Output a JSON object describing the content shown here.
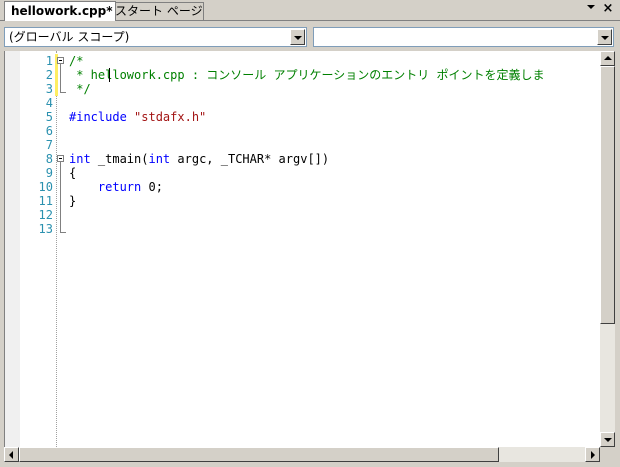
{
  "tabs": [
    {
      "label": "hellowork.cpp*",
      "active": true
    },
    {
      "label": "スタート ページ",
      "active": false
    }
  ],
  "tab_controls": {
    "dropdown_icon": "chevron-down-icon",
    "close_icon": "close-icon",
    "close_glyph": "×"
  },
  "navbar": {
    "scope_combo": "(グローバル スコープ)",
    "member_combo": ""
  },
  "colors": {
    "keyword": "#0000ff",
    "comment": "#008000",
    "string": "#a31515",
    "line_number": "#2b91af",
    "changed_line_marker": "#ffee62"
  },
  "editor": {
    "line_numbers": [
      "1",
      "2",
      "3",
      "4",
      "5",
      "6",
      "7",
      "8",
      "9",
      "10",
      "11",
      "12",
      "13"
    ],
    "lines": [
      [
        {
          "t": "/*",
          "c": "cm"
        }
      ],
      [
        {
          "t": " * hellowork.cpp : コンソール アプリケーションのエントリ ポイントを定義しま",
          "c": "cm"
        }
      ],
      [
        {
          "t": " */",
          "c": "cm"
        }
      ],
      [],
      [
        {
          "t": "#include ",
          "c": "kw"
        },
        {
          "t": "\"stdafx.h\"",
          "c": "st"
        }
      ],
      [],
      [],
      [
        {
          "t": "int",
          "c": "kw"
        },
        {
          "t": " _tmain(",
          "c": ""
        },
        {
          "t": "int",
          "c": "kw"
        },
        {
          "t": " argc, _TCHAR* argv[])",
          "c": ""
        }
      ],
      [
        {
          "t": "{",
          "c": ""
        }
      ],
      [
        {
          "t": "    ",
          "c": ""
        },
        {
          "t": "return",
          "c": "kw"
        },
        {
          "t": " 0;",
          "c": ""
        }
      ],
      [
        {
          "t": "}",
          "c": ""
        }
      ],
      [],
      []
    ]
  }
}
